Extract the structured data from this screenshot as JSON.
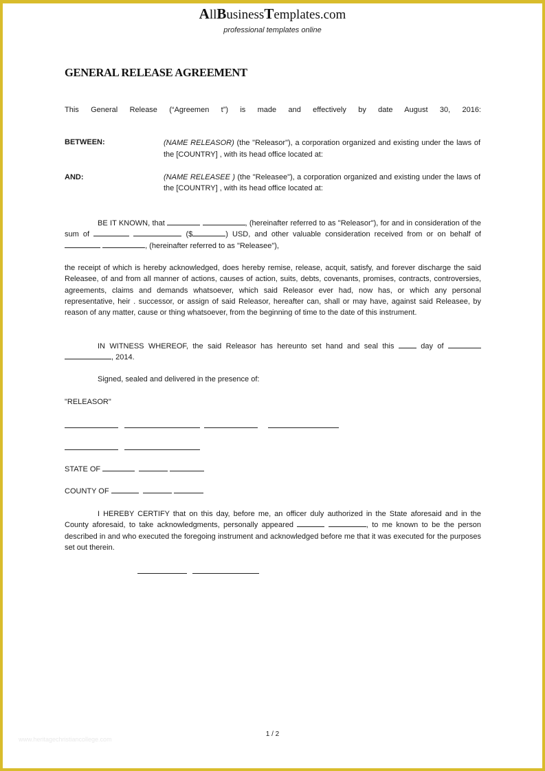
{
  "header": {
    "brand_parts": [
      {
        "text": "A",
        "big": true
      },
      {
        "text": "ll",
        "big": false
      },
      {
        "text": "B",
        "big": true
      },
      {
        "text": "usiness",
        "big": false
      },
      {
        "text": "T",
        "big": true
      },
      {
        "text": "emplates.com",
        "big": false
      }
    ],
    "brand": "AllBusinessTemplates.com",
    "tagline": "professional templates online"
  },
  "document": {
    "title": "GENERAL RELEASE AGREEMENT",
    "intro": "This General Release (“Agreemen t”) is made and effectively by date August 30, 2016:",
    "parties": [
      {
        "label": "BETWEEN:",
        "name": "(NAME RELEASOR)",
        "text": " (the \"Releasor\"), a corporation organized and existing under the laws of the [COUNTRY] , with its head office located at:"
      },
      {
        "label": "AND:",
        "name": "(NAME RELEASEE )",
        "text": " (the \"Releasee\"), a corporation organized and existing under the laws of the [COUNTRY] , with its head office located at:"
      }
    ],
    "be_it_known": {
      "part1": "BE IT KNOWN, that ",
      "part2": ", (hereinafter referred to as \"Releasor\"), for and in consideration of the sum of ",
      "part3": " ($",
      "part4": ") USD, and other valuable consideration received from or on behalf of ",
      "part5": ", (hereinafter referred to as \"Releasee\"),"
    },
    "release_clause": "the receipt of which is hereby acknowledged, does hereby remise, release, acquit, satisfy, and forever discharge the said Releasee, of and from all manner of actions, causes of action, suits, debts, covenants, promises, contracts, controversies, agreements, claims and demands whatsoever, which said Releasor ever had, now has, or which any personal representative, heir . successor, or assign of said Releasor, hereafter can, shall or may have, against said Releasee, by reason of any matter, cause or thing whatsoever, from the beginning of time to the date of this instrument.",
    "witness": {
      "part1": "IN WITNESS WHEREOF, the said Releasor has hereunto set hand and seal this ",
      "part2": " day of ",
      "part3": ", 2014."
    },
    "signed": "Signed, sealed and delivered in the presence of:",
    "releasor_label": "\"RELEASOR\"",
    "state_label": "STATE OF",
    "county_label": "COUNTY OF",
    "certify": {
      "part1": "I HEREBY CERTIFY that on this day, before me, an officer duly authorized in the State aforesaid and in the County aforesaid, to take acknowledgments, personally appeared ",
      "part2": ", to me known to be the person described in and who executed the foregoing instrument and acknowledged before me that it was executed for the purposes set out therein."
    }
  },
  "footer": {
    "page_number": "1 / 2",
    "watermark": "www.heritagechristiancollege.com"
  },
  "colors": {
    "frame": "#D9BC2C",
    "text": "#1a1a1a"
  }
}
